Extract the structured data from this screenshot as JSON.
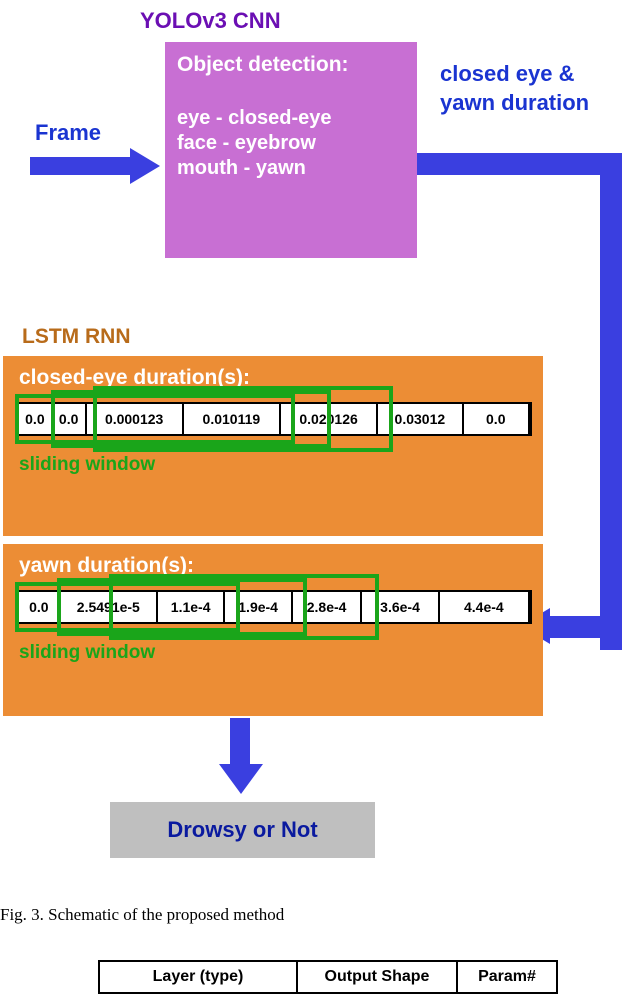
{
  "yolo_title": "YOLOv3 CNN",
  "frame_label": "Frame",
  "right_label_line1": "closed eye &",
  "right_label_line2": "yawn duration",
  "yolo_box": {
    "title": "Object detection:",
    "line1": "eye - closed-eye",
    "line2": "face - eyebrow",
    "line3": "mouth - yawn"
  },
  "lstm_label": "LSTM RNN",
  "panel1": {
    "title": "closed-eye duration(s):",
    "cells": [
      "0.0",
      "0.0",
      "0.000123",
      "0.010119",
      "0.020126",
      "0.03012",
      "0.0"
    ],
    "sliding": "sliding window"
  },
  "panel2": {
    "title": "yawn duration(s):",
    "cells": [
      "0.0",
      "2.5491e-5",
      "1.1e-4",
      "1.9e-4",
      "2.8e-4",
      "3.6e-4",
      "4.4e-4"
    ],
    "sliding": "sliding window"
  },
  "drowsy_label": "Drowsy or Not",
  "fig_caption": "Fig. 3.   Schematic of the proposed method",
  "table_headers": [
    "Layer (type)",
    "Output Shape",
    "Param#"
  ],
  "chart_data": {
    "type": "diagram",
    "description": "Pipeline: Frame → YOLOv3 CNN object detection (eye, closed-eye, face, eyebrow, mouth, yawn) → closed-eye & yawn duration time series → LSTM RNN with sliding window over duration sequences → Drowsy or Not classification",
    "series": [
      {
        "name": "closed-eye duration (s)",
        "values": [
          0.0,
          0.0,
          0.000123,
          0.010119,
          0.020126,
          0.03012,
          0.0
        ]
      },
      {
        "name": "yawn duration (s)",
        "values": [
          0.0,
          2.5491e-05,
          0.00011,
          0.00019,
          0.00028,
          0.00036,
          0.00044
        ]
      }
    ]
  }
}
